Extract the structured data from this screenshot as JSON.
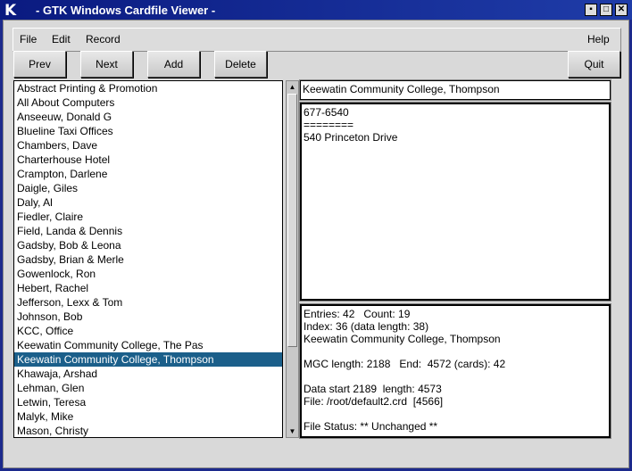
{
  "window": {
    "title": "- GTK Windows Cardfile Viewer -",
    "app_icon": "K",
    "controls": [
      "▪",
      "□",
      "✕"
    ]
  },
  "menu": [
    "File",
    "Edit",
    "Record",
    "Help"
  ],
  "toolbar": {
    "prev": "Prev",
    "next": "Next",
    "add": "Add",
    "delete": "Delete",
    "quit": "Quit"
  },
  "list": {
    "items": [
      "Abstract Printing & Promotion",
      "All About Computers",
      "Anseeuw, Donald G",
      "Blueline Taxi Offices",
      "Chambers, Dave",
      "Charterhouse Hotel",
      "Crampton, Darlene",
      "Daigle, Giles",
      "Daly, Al",
      "Fiedler, Claire",
      "Field, Landa & Dennis",
      "Gadsby, Bob & Leona",
      "Gadsby, Brian & Merle",
      "Gowenlock, Ron",
      "Hebert, Rachel",
      "Jefferson, Lexx & Tom",
      "Johnson, Bob",
      "KCC, Office",
      "Keewatin Community College, The Pas",
      "Keewatin Community College, Thompson",
      "Khawaja, Arshad",
      "Lehman, Glen",
      "Letwin, Teresa",
      "Malyk, Mike",
      "Mason, Christy"
    ],
    "selected": "Keewatin Community College, Thompson"
  },
  "card": {
    "title": "Keewatin Community College, Thompson",
    "body": [
      "677-6540",
      "========",
      "540 Princeton Drive"
    ]
  },
  "status": {
    "lines": [
      "Entries: 42   Count: 19",
      "Index: 36 (data length: 38)",
      "Keewatin Community College, Thompson",
      "",
      "MGC length: 2188   End:  4572 (cards): 42",
      "",
      "Data start 2189  length: 4573",
      "File: /root/default2.crd  [4566]",
      "",
      "File Status: ** Unchanged **"
    ]
  }
}
